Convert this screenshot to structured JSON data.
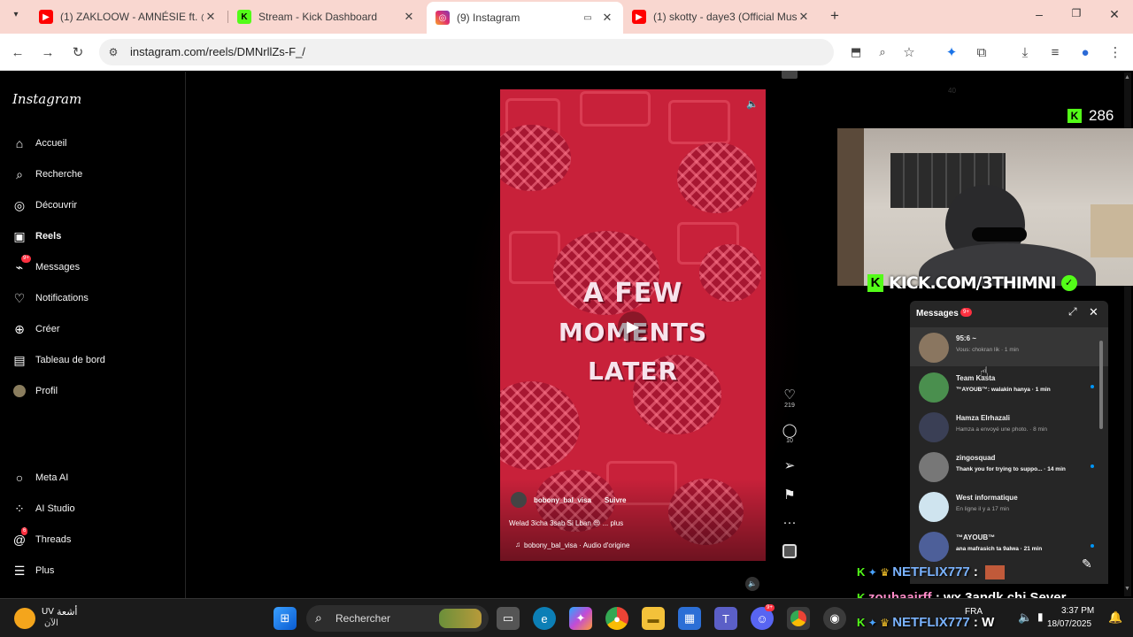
{
  "browser": {
    "tabs": [
      {
        "title": "(1) ZAKLOOW - AMNÉSIE ft. @",
        "favicon": "youtube-icon",
        "color": "#ff0000"
      },
      {
        "title": "Stream - Kick Dashboard",
        "favicon": "kick-icon",
        "color": "#53fc18"
      },
      {
        "title": "(9) Instagram",
        "favicon": "instagram-icon",
        "color": "#e1306c"
      },
      {
        "title": "(1) skotty - daye3 (Official Musi",
        "favicon": "youtube-icon",
        "color": "#ff0000"
      }
    ],
    "url": "instagram.com/reels/DMNrllZs-F_/",
    "extension_badge": "40"
  },
  "sidebar": {
    "logo": "Instagram",
    "items": [
      {
        "label": "Accueil",
        "icon": "home-icon"
      },
      {
        "label": "Recherche",
        "icon": "search-icon"
      },
      {
        "label": "Découvrir",
        "icon": "compass-icon"
      },
      {
        "label": "Reels",
        "icon": "reels-icon"
      },
      {
        "label": "Messages",
        "icon": "messenger-icon",
        "badge": "9+"
      },
      {
        "label": "Notifications",
        "icon": "heart-icon"
      },
      {
        "label": "Créer",
        "icon": "plus-icon"
      },
      {
        "label": "Tableau de bord",
        "icon": "dashboard-icon"
      },
      {
        "label": "Profil",
        "icon": "avatar-icon"
      }
    ],
    "bottom_items": [
      {
        "label": "Meta AI",
        "icon": "meta-ai-icon"
      },
      {
        "label": "AI Studio",
        "icon": "ai-studio-icon"
      },
      {
        "label": "Threads",
        "icon": "threads-icon",
        "badge": "6"
      },
      {
        "label": "Plus",
        "icon": "menu-icon"
      }
    ]
  },
  "reel": {
    "overlay_line1": "A FEW",
    "overlay_line2": "MOMENTS LATER",
    "author": "bobony_bal_visa",
    "follow": "Suivre",
    "caption": "Welad 3icha 3sab Si Lban 😔 ... plus",
    "audio": "bobony_bal_visa · Audio d'origine",
    "likes": "219",
    "comments": "10"
  },
  "stream": {
    "viewer_count": "286",
    "channel_banner": "KICK.COM/3THIMNI",
    "chat": [
      {
        "user": "NETFLIX777",
        "text": ":"
      },
      {
        "user": "zouhaairff",
        "text": ": wx 3andk chi Sever"
      },
      {
        "user": "NETFLIX777",
        "text": ": W"
      }
    ]
  },
  "messages_panel": {
    "title": "Messages",
    "badge": "9+",
    "conversations": [
      {
        "name": "95:6 ~",
        "preview": "Vous: chokran lik · 1 min",
        "unread": false,
        "avatar_color": "#8a7660"
      },
      {
        "name": "Team Kasta",
        "preview": "™AYOUB™: walakin hanya · 1 min",
        "unread": true,
        "avatar_color": "#4a8f4e"
      },
      {
        "name": "Hamza Elrhazali",
        "preview": "Hamza a envoyé une photo. · 8 min",
        "unread": false,
        "avatar_color": "#3a3f55"
      },
      {
        "name": "zingosquad",
        "preview": "Thank you for trying to suppo... · 14 min",
        "unread": true,
        "avatar_color": "#777777"
      },
      {
        "name": "West informatique",
        "preview": "En ligne il y a 17 min",
        "unread": false,
        "avatar_color": "#cfe4ef"
      },
      {
        "name": "™AYOUB™",
        "preview": "ana mafrasich ta 9alwa · 21 min",
        "unread": true,
        "avatar_color": "#4d5f99"
      }
    ]
  },
  "taskbar": {
    "weather_temp": "UV",
    "weather_line1": "أشعة",
    "weather_line2": "الآن",
    "search_placeholder": "Rechercher",
    "language": "FRA",
    "time": "3:37 PM",
    "date": "18/07/2025",
    "discord_badge": "9+"
  }
}
